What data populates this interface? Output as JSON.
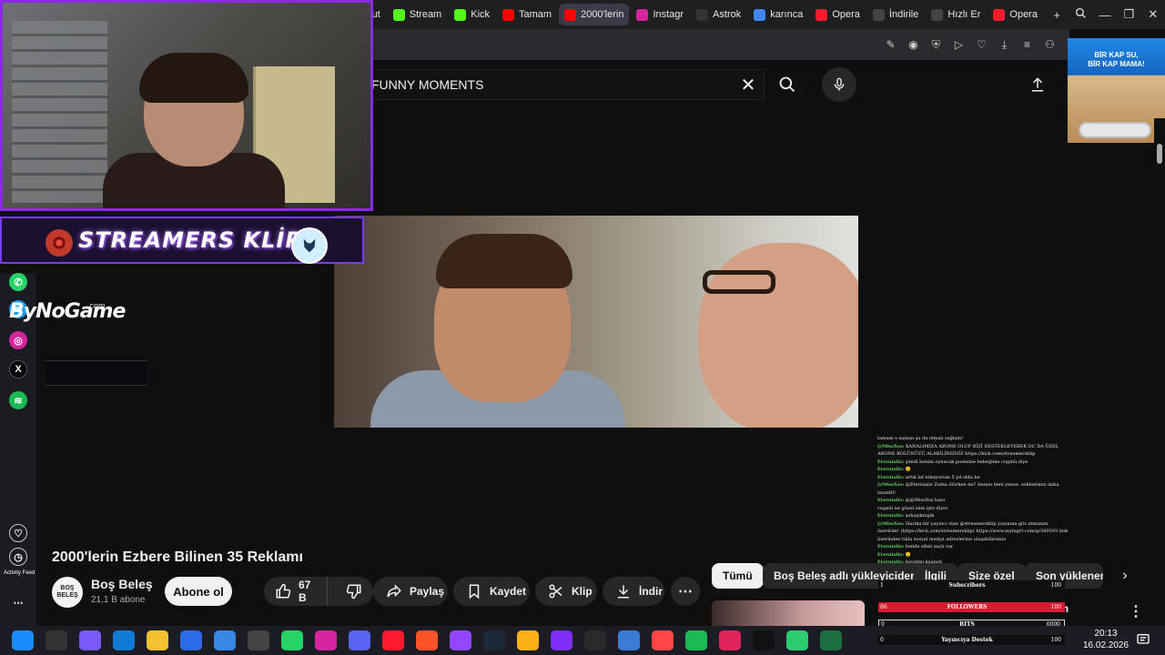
{
  "tabs": [
    {
      "label": "CapCut",
      "icon": "capcut-icon",
      "color": "#111111"
    },
    {
      "label": "Stream",
      "icon": "kick-icon",
      "color": "#53fc18"
    },
    {
      "label": "Kick",
      "icon": "kick-icon",
      "color": "#53fc18"
    },
    {
      "label": "Tamam",
      "icon": "youtube-icon",
      "color": "#ff0000"
    },
    {
      "label": "2000'lerin",
      "icon": "youtube-icon",
      "color": "#ff0000",
      "active": true
    },
    {
      "label": "Instagr",
      "icon": "instagram-icon",
      "color": "#d6249f"
    },
    {
      "label": "Astrok",
      "icon": "astro-icon",
      "color": "#333333"
    },
    {
      "label": "karınca",
      "icon": "google-icon",
      "color": "#4285f4"
    },
    {
      "label": "Opera",
      "icon": "opera-icon",
      "color": "#ff1b2d"
    },
    {
      "label": "İndirile",
      "icon": "download-icon",
      "color": "#444444"
    },
    {
      "label": "Hızlı Er",
      "icon": "grid-icon",
      "color": "#444444"
    },
    {
      "label": "Opera",
      "icon": "opera-icon",
      "color": "#ff1b2d"
    }
  ],
  "search": {
    "value": "FUNNY MOMENTS"
  },
  "overlay": {
    "banner_text": "STREAMERS KLİP",
    "brand": "ByNoGame",
    "brand_suffix": ".com",
    "activity_feed": "Activity Feed"
  },
  "chat": [
    {
      "user": "",
      "text": "tamam o zaman şu da olmalı sağlam!"
    },
    {
      "user": "@MissXss:",
      "text": "KANALIMIZA ABONE OLUP BİZİ DESTEKLEYEREK DC DA ÖZEL ABONE ROLÜNÜZÜ ALABİLİRSİNİZ https://kick.com/streamersklip"
    },
    {
      "user": "Eternializ:",
      "text": "şimdi benim oynacak pozesine bebeğime cugmü diye"
    },
    {
      "user": "Eternializ:",
      "text": "😊"
    },
    {
      "user": "Eternializ:",
      "text": "artık laf etmiyorum 5 yıl oldu be"
    },
    {
      "user": "@MissXss:",
      "text": "@Eternializ Zuma ölürken mi? Annen beni yense, sohbetimiz daha lezzetli!"
    },
    {
      "user": "Eternializ:",
      "text": "@@MissXss hanı"
    },
    {
      "user": "",
      "text": "cugmü ne güzel isim işte diyor"
    },
    {
      "user": "Eternializ:",
      "text": "şahaşiknajik"
    },
    {
      "user": "@MissXss:",
      "text": "Harika bir yayıncı olan @streamersklip yayınına göz atmanızı öneririm! (https://kick.com/streamersklip) https://www.mytagrt.com/p/389393 link üzerinden tıkla sosyal medya adreslerine ulaşabilirsiniz"
    },
    {
      "user": "Eternializ:",
      "text": "bende zihni zaçlı var"
    },
    {
      "user": "Eternializ:",
      "text": "😊"
    },
    {
      "user": "Eternializ:",
      "text": "bayatmı kaanob"
    },
    {
      "user": "Eternializ:",
      "text": "😊"
    }
  ],
  "ad": {
    "line1": "BİR KAP SU,",
    "line2": "BİR KAP MAMA!"
  },
  "video": {
    "title": "2000'lerin Ezbere Bilinen 35 Reklamı",
    "channel": "Boş Beleş",
    "subscribers": "21,1 B abone",
    "avatar_text": "BOŞ BELEŞ",
    "subscribe_label": "Abone ol",
    "likes": "67 B",
    "share_label": "Paylaş",
    "save_label": "Kaydet",
    "clip_label": "Klip",
    "download_label": "İndir"
  },
  "chips": [
    "Tümü",
    "Boş Beleş adlı yükleyiciden",
    "İlgili",
    "Size özel",
    "Son yüklenen"
  ],
  "related": {
    "title_fragment": "um"
  },
  "goals": {
    "subs": {
      "n1": "1",
      "label": "Subscribers",
      "n2": "100"
    },
    "followers": {
      "n1": "86",
      "label": "FOLLOWERS",
      "n2": "100"
    },
    "bits": {
      "n1": "0",
      "label": "BITS",
      "n2": "6000"
    },
    "destek": {
      "n1": "0",
      "label": "Yayıncıya Destek",
      "n2": "100"
    }
  },
  "clock": {
    "time": "20:13",
    "date": "16.02.2026"
  },
  "taskbar_icons": [
    {
      "name": "windows-start-icon",
      "color": "#1a8cff"
    },
    {
      "name": "search-icon",
      "color": "#333"
    },
    {
      "name": "copilot-icon",
      "color": "#7a5af8"
    },
    {
      "name": "edge-icon",
      "color": "#0f7bd4"
    },
    {
      "name": "file-explorer-icon",
      "color": "#f2c231"
    },
    {
      "name": "store-icon",
      "color": "#2b6be6"
    },
    {
      "name": "mail-icon",
      "color": "#3a86e6"
    },
    {
      "name": "speedometer-icon",
      "color": "#444"
    },
    {
      "name": "whatsapp-icon",
      "color": "#25d366"
    },
    {
      "name": "instagram-icon",
      "color": "#d6249f"
    },
    {
      "name": "discord-icon",
      "color": "#5865f2"
    },
    {
      "name": "opera-gx-icon",
      "color": "#ff1b2d"
    },
    {
      "name": "brave-icon",
      "color": "#fb542b"
    },
    {
      "name": "twitch-icon",
      "color": "#9146ff"
    },
    {
      "name": "steam-icon",
      "color": "#1b2838"
    },
    {
      "name": "rockstar-icon",
      "color": "#fcaf17"
    },
    {
      "name": "circle-app-icon",
      "color": "#7b2ff7"
    },
    {
      "name": "epic-games-icon",
      "color": "#2a2a2a"
    },
    {
      "name": "snowflake-icon",
      "color": "#3a7bd5"
    },
    {
      "name": "ea-icon",
      "color": "#ff4747"
    },
    {
      "name": "spotify-icon",
      "color": "#1db954"
    },
    {
      "name": "red-app-icon",
      "color": "#e0245e"
    },
    {
      "name": "tiktok-icon",
      "color": "#111"
    },
    {
      "name": "green-app-icon",
      "color": "#2ecc71"
    },
    {
      "name": "excel-icon",
      "color": "#1d6f42"
    }
  ]
}
